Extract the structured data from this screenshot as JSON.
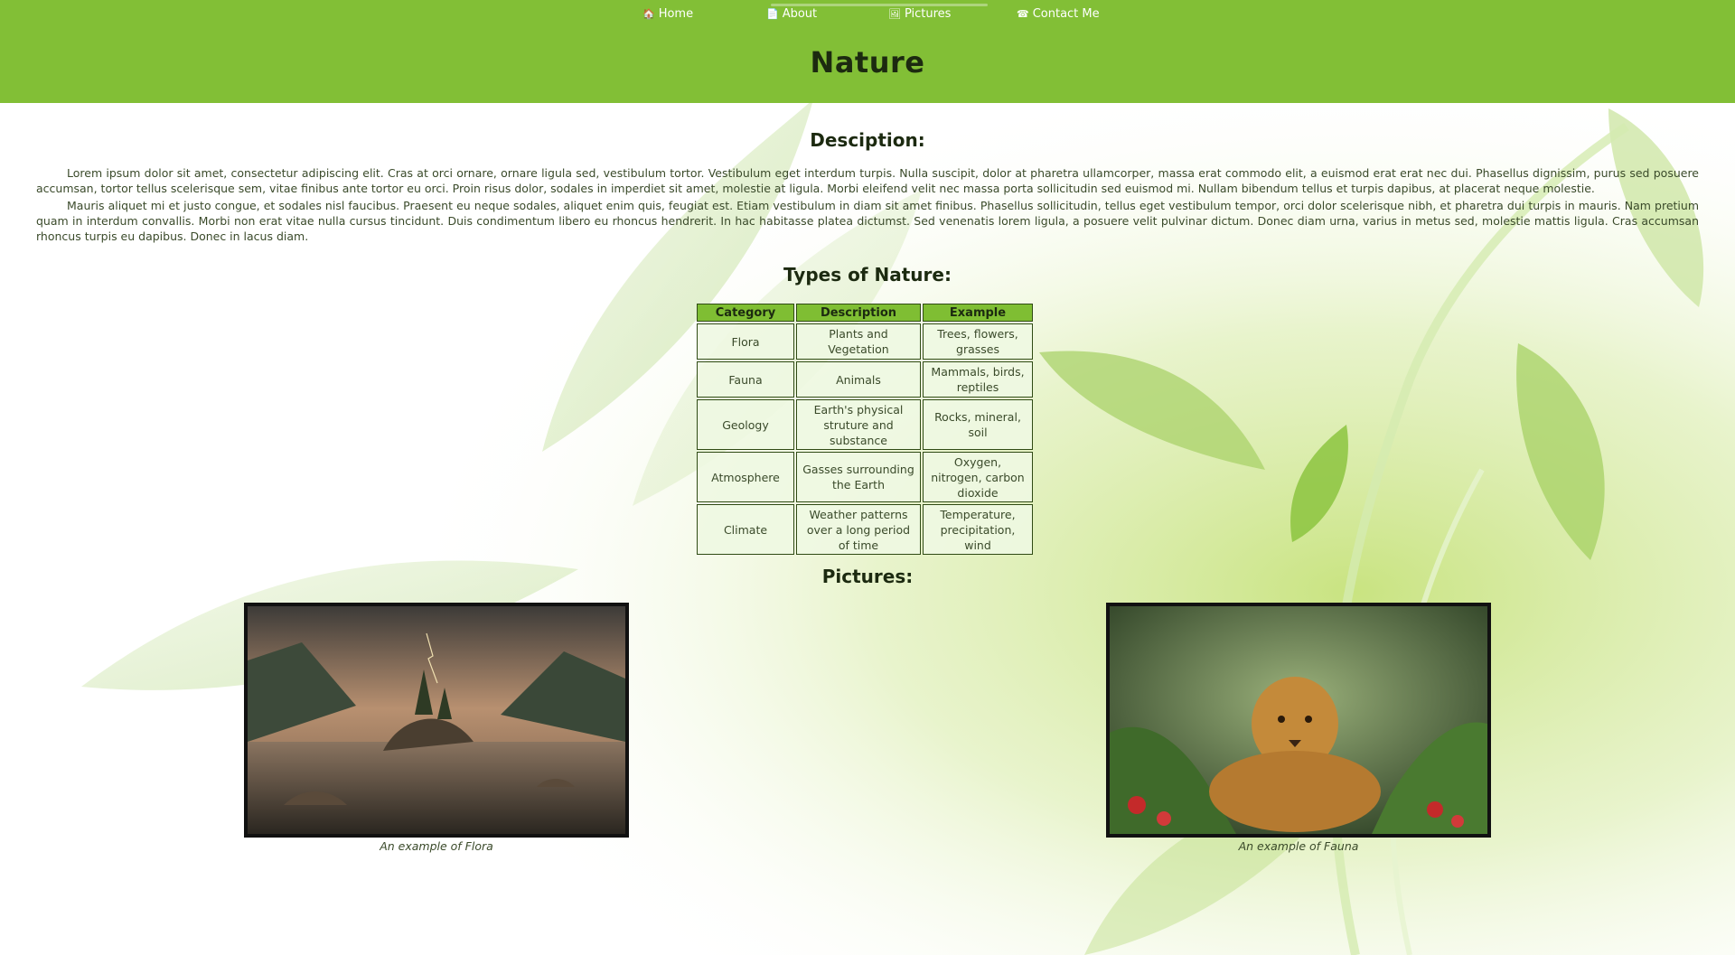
{
  "nav": {
    "items": [
      {
        "icon": "home-icon",
        "glyph": "🏠",
        "label": "Home"
      },
      {
        "icon": "document-icon",
        "glyph": "📄",
        "label": "About"
      },
      {
        "icon": "image-icon",
        "glyph": "🖼",
        "label": "Pictures"
      },
      {
        "icon": "phone-icon",
        "glyph": "☎",
        "label": "Contact Me"
      }
    ]
  },
  "header": {
    "title": "Nature",
    "background_color": "#82bf36"
  },
  "description": {
    "heading": "Desciption:",
    "paragraphs": [
      "Lorem ipsum dolor sit amet, consectetur adipiscing elit. Cras at orci ornare, ornare ligula sed, vestibulum tortor. Vestibulum eget interdum turpis. Nulla suscipit, dolor at pharetra ullamcorper, massa erat commodo elit, a euismod erat erat nec dui. Phasellus dignissim, purus sed posuere accumsan, tortor tellus scelerisque sem, vitae finibus ante tortor eu orci. Proin risus dolor, sodales in imperdiet sit amet, molestie at ligula. Morbi eleifend velit nec massa porta sollicitudin sed euismod mi. Nullam bibendum tellus et turpis dapibus, at placerat neque molestie.",
      "Mauris aliquet mi et justo congue, et sodales nisl faucibus. Praesent eu neque sodales, aliquet enim quis, feugiat est. Etiam vestibulum in diam sit amet finibus. Phasellus sollicitudin, tellus eget vestibulum tempor, orci dolor scelerisque nibh, et pharetra dui turpis in mauris. Nam pretium quam in interdum convallis. Morbi non erat vitae nulla cursus tincidunt. Duis condimentum libero eu rhoncus hendrerit. In hac habitasse platea dictumst. Sed venenatis lorem ligula, a posuere velit pulvinar dictum. Donec diam urna, varius in metus sed, molestie mattis ligula. Cras accumsan rhoncus turpis eu dapibus. Donec in lacus diam."
    ]
  },
  "types": {
    "heading": "Types of Nature:",
    "columns": [
      "Category",
      "Description",
      "Example"
    ],
    "rows": [
      [
        "Flora",
        "Plants and Vegetation",
        "Trees, flowers, grasses"
      ],
      [
        "Fauna",
        "Animals",
        "Mammals, birds, reptiles"
      ],
      [
        "Geology",
        "Earth's physical struture and substance",
        "Rocks, mineral, soil"
      ],
      [
        "Atmosphere",
        "Gasses surrounding the Earth",
        "Oxygen, nitrogen, carbon dioxide"
      ],
      [
        "Climate",
        "Weather patterns over a long period of time",
        "Temperature, precipitation, wind"
      ]
    ]
  },
  "pictures": {
    "heading": "Pictures:",
    "items": [
      {
        "caption": "An example of Flora"
      },
      {
        "caption": "An example of Fauna"
      }
    ]
  }
}
